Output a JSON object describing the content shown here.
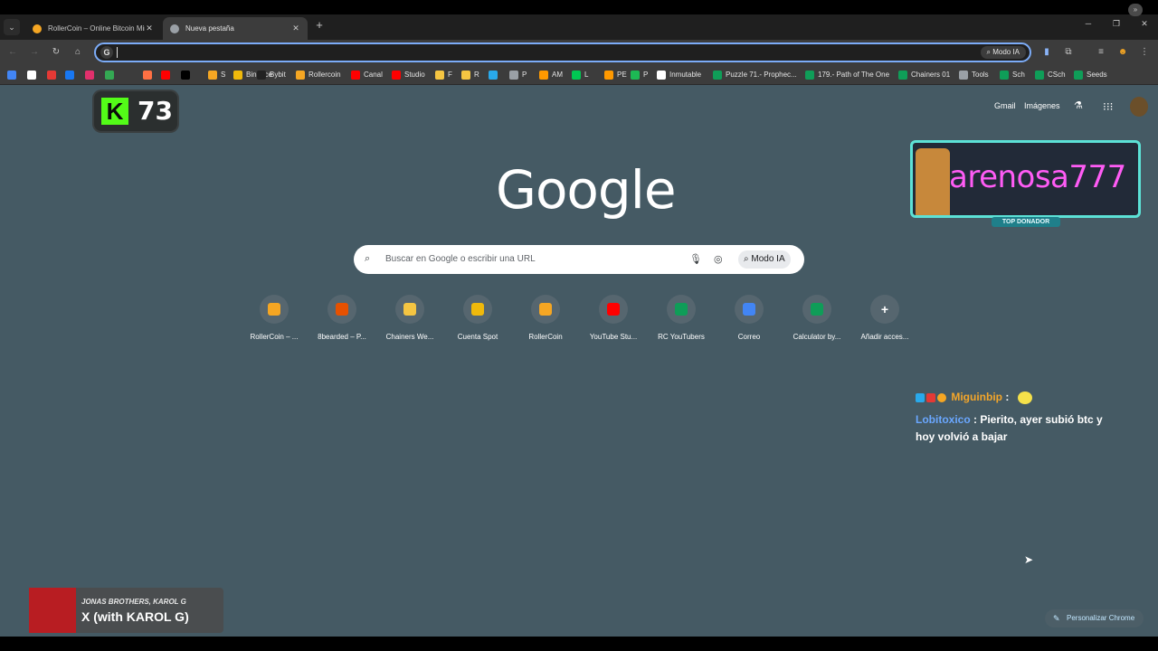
{
  "tabs": [
    {
      "title": "RollerCoin – Online Bitcoin Mining",
      "active": false,
      "icon": "rollercoin-icon"
    },
    {
      "title": "Nueva pestaña",
      "active": true,
      "icon": "chrome-icon"
    }
  ],
  "omnibox": {
    "value": "",
    "ai_mode_label": "Modo IA"
  },
  "bookmarks": [
    {
      "label": "",
      "color": "#4285f4"
    },
    {
      "label": "",
      "color": "#ffffff"
    },
    {
      "label": "",
      "color": "#e53935"
    },
    {
      "label": "",
      "color": "#1877f2"
    },
    {
      "label": "",
      "color": "#e1306c"
    },
    {
      "label": "",
      "color": "#34a853"
    },
    {
      "label": "",
      "color": "#ff7043"
    },
    {
      "label": "",
      "color": "#ff0000"
    },
    {
      "label": "",
      "color": "#000000"
    },
    {
      "label": "S",
      "color": "#f5a623"
    },
    {
      "label": "Binance",
      "color": "#f0b90b"
    },
    {
      "label": "Bybit",
      "color": "#222222"
    },
    {
      "label": "Rollercoin",
      "color": "#f5a623"
    },
    {
      "label": "Canal",
      "color": "#ff0000"
    },
    {
      "label": "Studio",
      "color": "#ff0000"
    },
    {
      "label": "F",
      "color": "#f5c542"
    },
    {
      "label": "R",
      "color": "#f5c542"
    },
    {
      "label": "",
      "color": "#29a9eb"
    },
    {
      "label": "P",
      "color": "#9aa0a6"
    },
    {
      "label": "AM",
      "color": "#ff9900"
    },
    {
      "label": "L",
      "color": "#00c853"
    },
    {
      "label": "PE",
      "color": "#ff9900"
    },
    {
      "label": "P",
      "color": "#1db954"
    },
    {
      "label": "Inmutable",
      "color": "#ffffff"
    },
    {
      "label": "Puzzle 71.- Prophec...",
      "color": "#0f9d58"
    },
    {
      "label": "179.- Path of The One",
      "color": "#0f9d58"
    },
    {
      "label": "Chainers 01",
      "color": "#0f9d58"
    },
    {
      "label": "Tools",
      "color": "#9aa0a6"
    },
    {
      "label": "Sch",
      "color": "#0f9d58"
    },
    {
      "label": "CSch",
      "color": "#0f9d58"
    },
    {
      "label": "Seeds",
      "color": "#0f9d58"
    }
  ],
  "header": {
    "gmail": "Gmail",
    "images": "Imágenes"
  },
  "logo": "Google",
  "search": {
    "placeholder": "Buscar en Google o escribir una URL",
    "ai_mode_label": "Modo IA"
  },
  "shortcuts": [
    {
      "label": "RollerCoin – ...",
      "icon": "rollercoin-icon",
      "color": "#f5a623"
    },
    {
      "label": "8bearded – P...",
      "icon": "bearded-icon",
      "color": "#e65100"
    },
    {
      "label": "Chainers We...",
      "icon": "chainers-icon",
      "color": "#f5c542"
    },
    {
      "label": "Cuenta Spot",
      "icon": "binance-icon",
      "color": "#f0b90b"
    },
    {
      "label": "RollerCoin",
      "icon": "rollercoin-icon",
      "color": "#f5a623"
    },
    {
      "label": "YouTube Stu...",
      "icon": "youtube-icon",
      "color": "#ff0000"
    },
    {
      "label": "RC YouTubers",
      "icon": "sheets-icon",
      "color": "#0f9d58"
    },
    {
      "label": "Correo",
      "icon": "mail-icon",
      "color": "#4285f4"
    },
    {
      "label": "Calculator by...",
      "icon": "sheets-icon",
      "color": "#0f9d58"
    },
    {
      "label": "Añadir acces...",
      "icon": "plus-icon",
      "color": "#56666f"
    }
  ],
  "kick": {
    "count": "73",
    "brand_color": "#53fc18"
  },
  "donor": {
    "name": "arenosa777",
    "tag": "TOP DONADOR"
  },
  "chat": [
    {
      "user": "Miguinbip",
      "text": ""
    },
    {
      "user": "Lobitoxico",
      "text": "Pierito, ayer subió btc y hoy volvió a bajar"
    }
  ],
  "music": {
    "artist": "JONAS BROTHERS, KAROL G",
    "title": "X (with KAROL G)"
  },
  "customize": {
    "label": "Personalizar Chrome"
  }
}
